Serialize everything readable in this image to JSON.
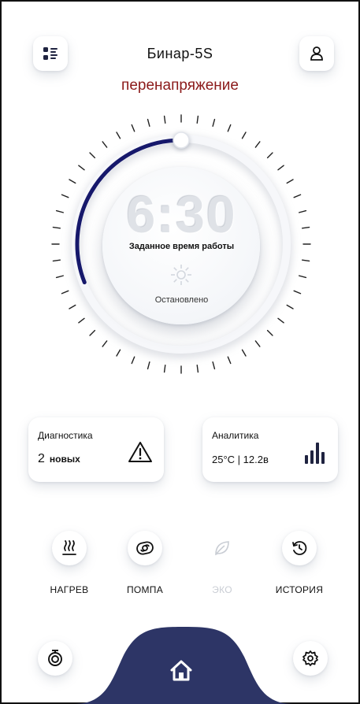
{
  "header": {
    "title": "Бинар-5S",
    "status": "перенапряжение",
    "menu_icon": "list-icon",
    "profile_icon": "user-icon"
  },
  "dial": {
    "time": "6:30",
    "label": "Заданное время работы",
    "state": "Остановлено",
    "state_icon": "sun-icon",
    "progress_fraction": 0.31,
    "accent_color": "#16186b"
  },
  "cards": {
    "diagnostics": {
      "title": "Диагностика",
      "count": "2",
      "unit": "новых",
      "icon": "warning-icon"
    },
    "analytics": {
      "title": "Аналитика",
      "value": "25°C | 12.2в",
      "icon": "bar-chart-icon"
    }
  },
  "modes": [
    {
      "label": "НАГРЕВ",
      "icon": "heat-icon",
      "enabled": true
    },
    {
      "label": "ПОМПА",
      "icon": "pump-icon",
      "enabled": true
    },
    {
      "label": "ЭКО",
      "icon": "leaf-icon",
      "enabled": false
    },
    {
      "label": "ИСТОРИЯ",
      "icon": "history-icon",
      "enabled": true
    }
  ],
  "bottom_bar": {
    "left_icon": "timer-icon",
    "center_icon": "home-icon",
    "right_icon": "settings-icon",
    "center_color": "#2d3566"
  }
}
